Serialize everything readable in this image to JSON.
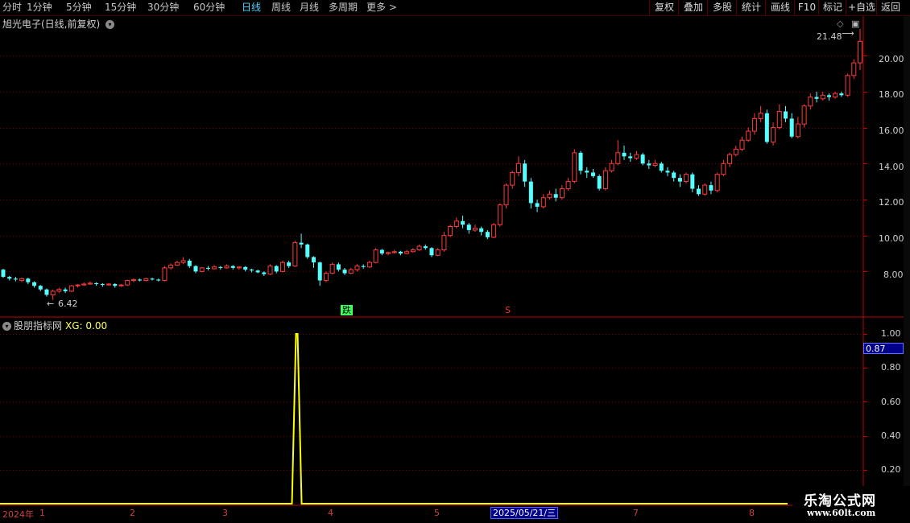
{
  "toolbar": {
    "periods": [
      "分时",
      "1分钟",
      "5分钟",
      "15分钟",
      "30分钟",
      "60分钟",
      "日线",
      "周线",
      "月线",
      "多周期",
      "更多 >"
    ],
    "active_period": "日线",
    "right_buttons": [
      "复权",
      "叠加",
      "多股",
      "统计",
      "画线",
      "F10",
      "标记",
      "+自选",
      "返回"
    ]
  },
  "main_chart": {
    "stock_title": "旭光电子(日线,前复权)",
    "y_ticks": [
      "20.00",
      "18.00",
      "16.00",
      "14.00",
      "12.00",
      "10.00",
      "8.00"
    ],
    "high_label": "21.48",
    "low_label": "6.42",
    "signal_die": "跌",
    "signal_s": "S"
  },
  "indicator": {
    "title": "股朋指标网",
    "xg_label": "XG: 0.00",
    "y_ticks": [
      "1.00",
      "0.80",
      "0.60",
      "0.40",
      "0.20"
    ],
    "current_value": "0.87"
  },
  "date_axis": {
    "year_label": "2024年",
    "months": [
      "1",
      "2",
      "3",
      "4",
      "5",
      "7",
      "8"
    ],
    "selected_date": "2025/05/21/三"
  },
  "watermark": {
    "name": "乐淘公式网",
    "url": "www.60lt.com"
  },
  "colors": {
    "up": "#ff3b3b",
    "down": "#54ffff",
    "grid": "#7a0000",
    "indicator_line": "#ffff00"
  },
  "chart_data": [
    {
      "type": "candlestick",
      "title": "旭光电子(日线,前复权)",
      "yticks": [
        20,
        18,
        16,
        14,
        12,
        10,
        8
      ],
      "ylim": [
        6.2,
        22.2
      ],
      "high": 21.48,
      "low": 6.42,
      "candles": [
        [
          8.1,
          7.7,
          8.15,
          7.65
        ],
        [
          7.7,
          7.6,
          7.75,
          7.5
        ],
        [
          7.6,
          7.55,
          7.7,
          7.45
        ],
        [
          7.5,
          7.6,
          7.65,
          7.4
        ],
        [
          7.6,
          7.4,
          7.65,
          7.3
        ],
        [
          7.4,
          7.2,
          7.45,
          7.1
        ],
        [
          7.2,
          7.0,
          7.25,
          6.9
        ],
        [
          7.0,
          6.7,
          7.05,
          6.6
        ],
        [
          6.7,
          6.9,
          7.0,
          6.42
        ],
        [
          6.9,
          7.0,
          7.1,
          6.8
        ],
        [
          7.0,
          6.9,
          7.1,
          6.8
        ],
        [
          6.9,
          7.2,
          7.25,
          6.85
        ],
        [
          7.2,
          7.25,
          7.3,
          7.1
        ],
        [
          7.25,
          7.3,
          7.4,
          7.2
        ],
        [
          7.3,
          7.35,
          7.45,
          7.25
        ],
        [
          7.35,
          7.3,
          7.4,
          7.2
        ],
        [
          7.3,
          7.25,
          7.35,
          7.15
        ],
        [
          7.25,
          7.3,
          7.35,
          7.2
        ],
        [
          7.3,
          7.2,
          7.35,
          7.1
        ],
        [
          7.2,
          7.25,
          7.3,
          7.15
        ],
        [
          7.25,
          7.5,
          7.55,
          7.2
        ],
        [
          7.5,
          7.55,
          7.6,
          7.4
        ],
        [
          7.55,
          7.5,
          7.6,
          7.45
        ],
        [
          7.5,
          7.6,
          7.65,
          7.45
        ],
        [
          7.6,
          7.55,
          7.65,
          7.5
        ],
        [
          7.55,
          7.5,
          7.6,
          7.45
        ],
        [
          7.5,
          8.2,
          8.3,
          7.45
        ],
        [
          8.2,
          8.35,
          8.45,
          8.1
        ],
        [
          8.35,
          8.5,
          8.6,
          8.3
        ],
        [
          8.5,
          8.6,
          8.8,
          8.4
        ],
        [
          8.6,
          8.3,
          8.7,
          8.2
        ],
        [
          8.3,
          8.0,
          8.35,
          7.9
        ],
        [
          8.0,
          8.2,
          8.25,
          7.95
        ],
        [
          8.2,
          8.15,
          8.3,
          8.05
        ],
        [
          8.15,
          8.25,
          8.35,
          8.1
        ],
        [
          8.25,
          8.2,
          8.3,
          8.1
        ],
        [
          8.2,
          8.3,
          8.4,
          8.15
        ],
        [
          8.3,
          8.2,
          8.35,
          8.1
        ],
        [
          8.2,
          8.25,
          8.3,
          8.1
        ],
        [
          8.25,
          8.1,
          8.3,
          8.0
        ],
        [
          8.1,
          8.05,
          8.15,
          7.95
        ],
        [
          8.05,
          7.95,
          8.1,
          7.9
        ],
        [
          7.95,
          7.85,
          8.0,
          7.75
        ],
        [
          7.85,
          8.3,
          8.4,
          7.8
        ],
        [
          8.3,
          8.0,
          8.35,
          7.9
        ],
        [
          8.0,
          8.5,
          8.6,
          7.95
        ],
        [
          8.5,
          8.3,
          8.6,
          8.2
        ],
        [
          8.3,
          9.6,
          9.7,
          8.25
        ],
        [
          9.6,
          9.5,
          10.1,
          9.3
        ],
        [
          9.5,
          8.8,
          9.55,
          8.7
        ],
        [
          8.8,
          8.5,
          8.85,
          8.2
        ],
        [
          8.5,
          7.5,
          8.55,
          7.2
        ],
        [
          7.5,
          7.9,
          8.0,
          7.4
        ],
        [
          7.9,
          8.4,
          8.5,
          7.85
        ],
        [
          8.4,
          8.1,
          8.5,
          8.0
        ],
        [
          8.1,
          7.9,
          8.2,
          7.8
        ],
        [
          7.9,
          8.1,
          8.2,
          7.85
        ],
        [
          8.1,
          8.3,
          8.4,
          8.0
        ],
        [
          8.3,
          8.25,
          8.4,
          8.15
        ],
        [
          8.25,
          8.5,
          8.6,
          8.2
        ],
        [
          8.5,
          9.2,
          9.3,
          8.45
        ],
        [
          9.2,
          9.0,
          9.25,
          8.9
        ],
        [
          9.0,
          9.05,
          9.1,
          8.9
        ],
        [
          9.05,
          9.1,
          9.2,
          9.0
        ],
        [
          9.1,
          9.0,
          9.15,
          8.9
        ],
        [
          9.0,
          9.1,
          9.2,
          8.95
        ],
        [
          9.1,
          9.2,
          9.3,
          9.05
        ],
        [
          9.2,
          9.4,
          9.5,
          9.15
        ],
        [
          9.4,
          9.3,
          9.5,
          9.2
        ],
        [
          9.3,
          8.9,
          9.35,
          8.8
        ],
        [
          8.9,
          9.2,
          9.3,
          8.85
        ],
        [
          9.2,
          10.0,
          10.2,
          9.1
        ],
        [
          10.0,
          10.5,
          10.6,
          9.9
        ],
        [
          10.5,
          10.8,
          11.0,
          10.4
        ],
        [
          10.8,
          10.6,
          11.1,
          10.4
        ],
        [
          10.6,
          10.3,
          10.7,
          10.1
        ],
        [
          10.3,
          10.4,
          10.6,
          10.2
        ],
        [
          10.4,
          10.2,
          10.5,
          10.0
        ],
        [
          10.2,
          9.9,
          10.3,
          9.8
        ],
        [
          9.9,
          10.6,
          10.7,
          9.85
        ],
        [
          10.6,
          11.7,
          11.8,
          10.5
        ],
        [
          11.7,
          12.8,
          12.9,
          11.5
        ],
        [
          12.8,
          13.5,
          13.6,
          12.6
        ],
        [
          13.5,
          14.0,
          14.4,
          13.3
        ],
        [
          14.0,
          13.0,
          14.2,
          12.7
        ],
        [
          13.0,
          11.8,
          13.2,
          11.5
        ],
        [
          11.8,
          11.6,
          12.0,
          11.3
        ],
        [
          11.6,
          12.1,
          12.3,
          11.5
        ],
        [
          12.1,
          12.3,
          12.5,
          12.0
        ],
        [
          12.3,
          12.1,
          12.6,
          11.9
        ],
        [
          12.1,
          12.6,
          12.8,
          12.0
        ],
        [
          12.6,
          13.0,
          13.2,
          12.5
        ],
        [
          13.0,
          14.6,
          14.8,
          12.9
        ],
        [
          14.6,
          13.6,
          14.7,
          13.4
        ],
        [
          13.6,
          13.5,
          13.8,
          13.2
        ],
        [
          13.5,
          13.3,
          13.7,
          13.2
        ],
        [
          13.3,
          12.6,
          13.4,
          12.5
        ],
        [
          12.6,
          13.6,
          13.8,
          12.5
        ],
        [
          13.6,
          14.0,
          14.2,
          13.5
        ],
        [
          14.0,
          14.6,
          15.3,
          13.9
        ],
        [
          14.6,
          14.4,
          15.0,
          14.2
        ],
        [
          14.4,
          14.3,
          14.6,
          14.1
        ],
        [
          14.3,
          14.5,
          14.7,
          14.2
        ],
        [
          14.5,
          14.0,
          14.6,
          13.9
        ],
        [
          14.0,
          13.9,
          14.2,
          13.7
        ],
        [
          13.9,
          14.0,
          14.2,
          13.8
        ],
        [
          14.0,
          13.6,
          14.1,
          13.5
        ],
        [
          13.6,
          13.5,
          13.8,
          13.3
        ],
        [
          13.5,
          13.2,
          13.6,
          13.0
        ],
        [
          13.2,
          13.0,
          13.4,
          12.7
        ],
        [
          13.0,
          13.4,
          13.5,
          12.9
        ],
        [
          13.4,
          12.6,
          13.5,
          12.4
        ],
        [
          12.6,
          12.3,
          12.8,
          12.2
        ],
        [
          12.3,
          12.8,
          12.9,
          12.2
        ],
        [
          12.8,
          12.5,
          13.0,
          12.3
        ],
        [
          12.5,
          13.4,
          13.5,
          12.4
        ],
        [
          13.4,
          14.0,
          14.2,
          13.3
        ],
        [
          14.0,
          14.5,
          14.6,
          13.8
        ],
        [
          14.5,
          14.8,
          15.0,
          14.4
        ],
        [
          14.8,
          15.3,
          15.5,
          14.7
        ],
        [
          15.3,
          15.8,
          16.0,
          15.2
        ],
        [
          15.8,
          16.5,
          16.8,
          15.6
        ],
        [
          16.5,
          16.8,
          17.2,
          16.3
        ],
        [
          16.8,
          15.2,
          17.0,
          15.1
        ],
        [
          15.2,
          16.0,
          16.3,
          15.0
        ],
        [
          16.0,
          16.9,
          17.3,
          15.9
        ],
        [
          16.9,
          16.5,
          17.2,
          16.3
        ],
        [
          16.5,
          15.5,
          16.8,
          15.4
        ],
        [
          15.5,
          16.2,
          16.6,
          15.4
        ],
        [
          16.2,
          17.2,
          17.3,
          16.0
        ],
        [
          17.2,
          17.7,
          17.9,
          17.0
        ],
        [
          17.7,
          17.6,
          18.0,
          17.4
        ],
        [
          17.6,
          17.8,
          18.0,
          17.5
        ],
        [
          17.8,
          17.7,
          17.9,
          17.5
        ],
        [
          17.7,
          17.9,
          18.0,
          17.6
        ],
        [
          17.9,
          17.8,
          18.0,
          17.7
        ],
        [
          17.8,
          18.9,
          19.0,
          17.7
        ],
        [
          18.9,
          19.6,
          19.8,
          18.7
        ],
        [
          19.6,
          20.8,
          21.48,
          19.2
        ]
      ]
    },
    {
      "type": "line",
      "title": "股朋指标网",
      "series": [
        {
          "name": "XG",
          "spike_index": 43,
          "spike_value": 1.0,
          "baseline": 0.0
        }
      ],
      "yticks": [
        1.0,
        0.8,
        0.6,
        0.4,
        0.2
      ],
      "ylim": [
        -0.05,
        1.05
      ]
    }
  ]
}
